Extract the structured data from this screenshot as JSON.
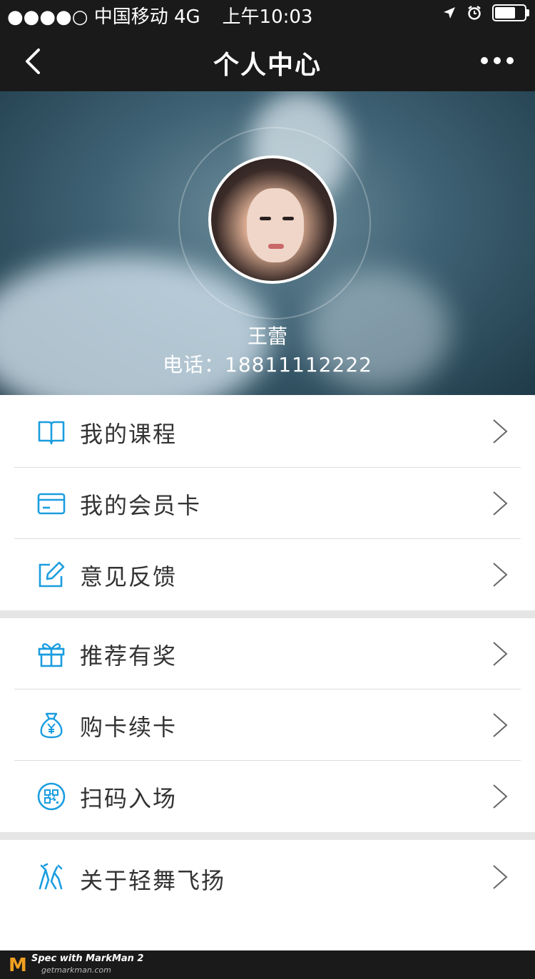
{
  "status_bar": {
    "carrier": "●●●●○ 中国移动  4G",
    "time": "上午10:03"
  },
  "nav": {
    "title": "个人中心"
  },
  "profile": {
    "name": "王蕾",
    "phone_label": "电话：18811112222"
  },
  "menu_group1": [
    {
      "label": "我的课程",
      "icon": "book-icon"
    },
    {
      "label": "我的会员卡",
      "icon": "card-icon"
    },
    {
      "label": "意见反馈",
      "icon": "edit-icon"
    }
  ],
  "menu_group2": [
    {
      "label": "推荐有奖",
      "icon": "gift-icon"
    },
    {
      "label": "购卡续卡",
      "icon": "money-bag-icon"
    },
    {
      "label": "扫码入场",
      "icon": "qr-scan-icon"
    }
  ],
  "menu_group3": [
    {
      "label": "关于轻舞飞扬",
      "icon": "dance-icon"
    }
  ],
  "footer": {
    "brand": "Spec with MarkMan 2",
    "site": "getmarkman.com"
  },
  "colors": {
    "accent": "#1a9de0",
    "bar": "#1a1a1a",
    "separator": "#e5e5e5"
  }
}
